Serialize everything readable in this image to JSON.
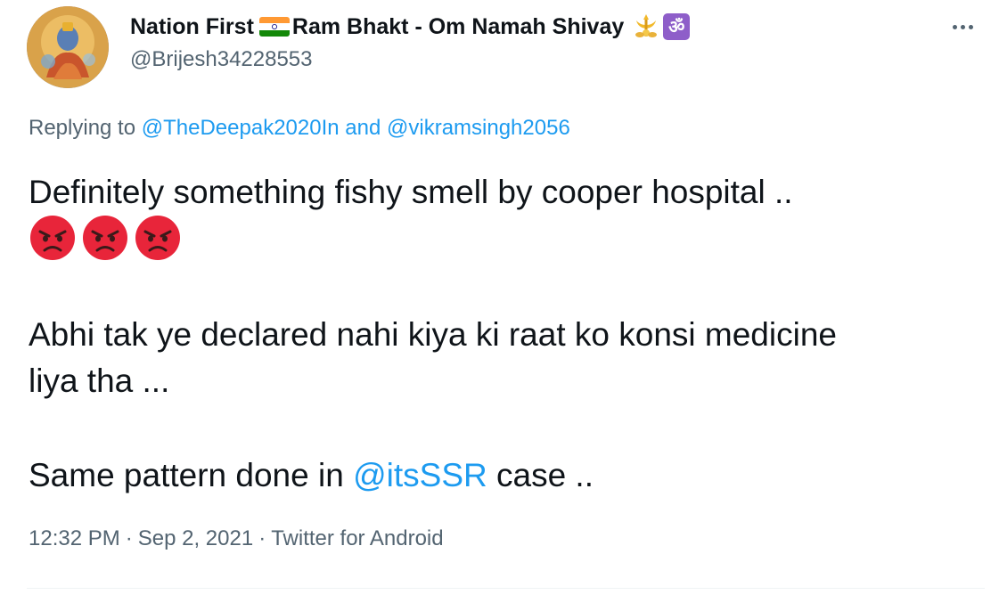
{
  "author": {
    "display_name_part1": "Nation First",
    "display_name_part2": "Ram Bhakt - Om Namah Shivay",
    "om_symbol": "ॐ",
    "handle": "@Brijesh34228553",
    "flag_icon": "india-flag-icon",
    "trishul_icon": "trishul-icon",
    "avatar_icon": "avatar-image"
  },
  "more_icon": "more-options-icon",
  "reply": {
    "prefix": "Replying to",
    "mention1": "@TheDeepak2020In",
    "and_text": "and",
    "mention2": "@vikramsingh2056"
  },
  "body": {
    "line1": "Definitely something fishy smell by cooper hospital ..",
    "emoji_name": "angry-face-icon",
    "line2": "Abhi tak ye declared nahi kiya ki raat ko konsi medicine",
    "line3": "liya tha ...",
    "line4_before": "Same pattern done in",
    "line4_mention": "@itsSSR",
    "line4_after": "case .."
  },
  "meta": {
    "time": "12:32 PM",
    "separator": "·",
    "date": "Sep 2, 2021",
    "source": "Twitter for Android"
  },
  "colors": {
    "link": "#1d9bf0",
    "secondary_text": "#536471",
    "primary_text": "#0f1419",
    "angry_red": "#e8253a"
  }
}
